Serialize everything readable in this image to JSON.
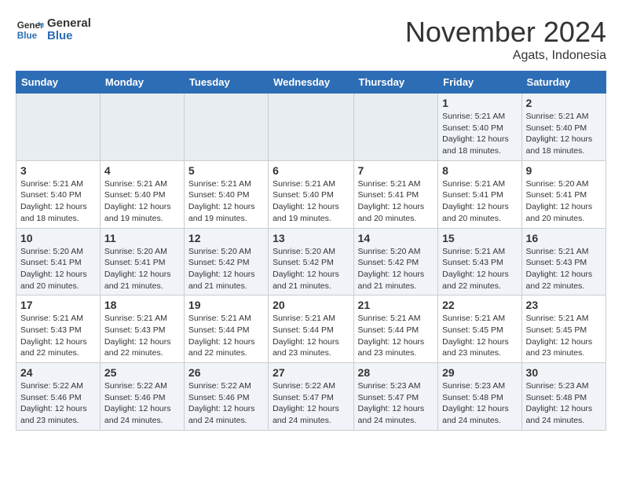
{
  "header": {
    "logo_line1": "General",
    "logo_line2": "Blue",
    "month": "November 2024",
    "location": "Agats, Indonesia"
  },
  "weekdays": [
    "Sunday",
    "Monday",
    "Tuesday",
    "Wednesday",
    "Thursday",
    "Friday",
    "Saturday"
  ],
  "weeks": [
    [
      {
        "day": "",
        "info": ""
      },
      {
        "day": "",
        "info": ""
      },
      {
        "day": "",
        "info": ""
      },
      {
        "day": "",
        "info": ""
      },
      {
        "day": "",
        "info": ""
      },
      {
        "day": "1",
        "info": "Sunrise: 5:21 AM\nSunset: 5:40 PM\nDaylight: 12 hours\nand 18 minutes."
      },
      {
        "day": "2",
        "info": "Sunrise: 5:21 AM\nSunset: 5:40 PM\nDaylight: 12 hours\nand 18 minutes."
      }
    ],
    [
      {
        "day": "3",
        "info": "Sunrise: 5:21 AM\nSunset: 5:40 PM\nDaylight: 12 hours\nand 18 minutes."
      },
      {
        "day": "4",
        "info": "Sunrise: 5:21 AM\nSunset: 5:40 PM\nDaylight: 12 hours\nand 19 minutes."
      },
      {
        "day": "5",
        "info": "Sunrise: 5:21 AM\nSunset: 5:40 PM\nDaylight: 12 hours\nand 19 minutes."
      },
      {
        "day": "6",
        "info": "Sunrise: 5:21 AM\nSunset: 5:40 PM\nDaylight: 12 hours\nand 19 minutes."
      },
      {
        "day": "7",
        "info": "Sunrise: 5:21 AM\nSunset: 5:41 PM\nDaylight: 12 hours\nand 20 minutes."
      },
      {
        "day": "8",
        "info": "Sunrise: 5:21 AM\nSunset: 5:41 PM\nDaylight: 12 hours\nand 20 minutes."
      },
      {
        "day": "9",
        "info": "Sunrise: 5:20 AM\nSunset: 5:41 PM\nDaylight: 12 hours\nand 20 minutes."
      }
    ],
    [
      {
        "day": "10",
        "info": "Sunrise: 5:20 AM\nSunset: 5:41 PM\nDaylight: 12 hours\nand 20 minutes."
      },
      {
        "day": "11",
        "info": "Sunrise: 5:20 AM\nSunset: 5:41 PM\nDaylight: 12 hours\nand 21 minutes."
      },
      {
        "day": "12",
        "info": "Sunrise: 5:20 AM\nSunset: 5:42 PM\nDaylight: 12 hours\nand 21 minutes."
      },
      {
        "day": "13",
        "info": "Sunrise: 5:20 AM\nSunset: 5:42 PM\nDaylight: 12 hours\nand 21 minutes."
      },
      {
        "day": "14",
        "info": "Sunrise: 5:20 AM\nSunset: 5:42 PM\nDaylight: 12 hours\nand 21 minutes."
      },
      {
        "day": "15",
        "info": "Sunrise: 5:21 AM\nSunset: 5:43 PM\nDaylight: 12 hours\nand 22 minutes."
      },
      {
        "day": "16",
        "info": "Sunrise: 5:21 AM\nSunset: 5:43 PM\nDaylight: 12 hours\nand 22 minutes."
      }
    ],
    [
      {
        "day": "17",
        "info": "Sunrise: 5:21 AM\nSunset: 5:43 PM\nDaylight: 12 hours\nand 22 minutes."
      },
      {
        "day": "18",
        "info": "Sunrise: 5:21 AM\nSunset: 5:43 PM\nDaylight: 12 hours\nand 22 minutes."
      },
      {
        "day": "19",
        "info": "Sunrise: 5:21 AM\nSunset: 5:44 PM\nDaylight: 12 hours\nand 22 minutes."
      },
      {
        "day": "20",
        "info": "Sunrise: 5:21 AM\nSunset: 5:44 PM\nDaylight: 12 hours\nand 23 minutes."
      },
      {
        "day": "21",
        "info": "Sunrise: 5:21 AM\nSunset: 5:44 PM\nDaylight: 12 hours\nand 23 minutes."
      },
      {
        "day": "22",
        "info": "Sunrise: 5:21 AM\nSunset: 5:45 PM\nDaylight: 12 hours\nand 23 minutes."
      },
      {
        "day": "23",
        "info": "Sunrise: 5:21 AM\nSunset: 5:45 PM\nDaylight: 12 hours\nand 23 minutes."
      }
    ],
    [
      {
        "day": "24",
        "info": "Sunrise: 5:22 AM\nSunset: 5:46 PM\nDaylight: 12 hours\nand 23 minutes."
      },
      {
        "day": "25",
        "info": "Sunrise: 5:22 AM\nSunset: 5:46 PM\nDaylight: 12 hours\nand 24 minutes."
      },
      {
        "day": "26",
        "info": "Sunrise: 5:22 AM\nSunset: 5:46 PM\nDaylight: 12 hours\nand 24 minutes."
      },
      {
        "day": "27",
        "info": "Sunrise: 5:22 AM\nSunset: 5:47 PM\nDaylight: 12 hours\nand 24 minutes."
      },
      {
        "day": "28",
        "info": "Sunrise: 5:23 AM\nSunset: 5:47 PM\nDaylight: 12 hours\nand 24 minutes."
      },
      {
        "day": "29",
        "info": "Sunrise: 5:23 AM\nSunset: 5:48 PM\nDaylight: 12 hours\nand 24 minutes."
      },
      {
        "day": "30",
        "info": "Sunrise: 5:23 AM\nSunset: 5:48 PM\nDaylight: 12 hours\nand 24 minutes."
      }
    ]
  ]
}
